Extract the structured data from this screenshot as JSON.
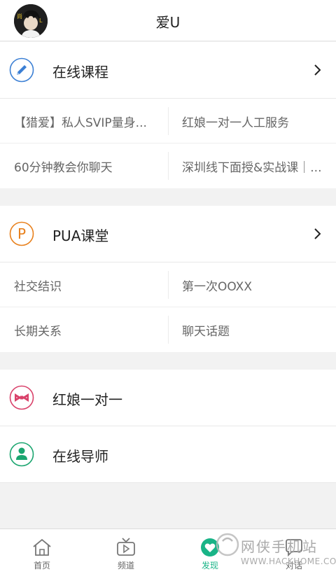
{
  "header": {
    "title": "爱U",
    "avatar": "user-avatar"
  },
  "courses": {
    "title": "在线课程",
    "icon": "pencil-icon",
    "items": [
      "【猎爱】私人SVIP量身...",
      "红娘一对一人工服务",
      "60分钟教会你聊天",
      "深圳线下面授&实战课｜..."
    ]
  },
  "pua": {
    "title": "PUA课堂",
    "icon": "p-badge-icon",
    "items": [
      "社交结识",
      "第一次OOXX",
      "长期关系",
      "聊天话题"
    ]
  },
  "matchmaker": {
    "title": "红娘一对一",
    "icon": "bow-icon"
  },
  "mentor": {
    "title": "在线导师",
    "icon": "person-icon"
  },
  "tabbar": {
    "tabs": [
      {
        "label": "首页",
        "icon": "home-icon"
      },
      {
        "label": "频道",
        "icon": "tv-icon"
      },
      {
        "label": "发现",
        "icon": "discover-icon",
        "active": true
      },
      {
        "label": "对话",
        "icon": "chat-icon"
      }
    ]
  },
  "watermark": {
    "text": "网侠手机站",
    "url": "WWW.HACKHOME.COM"
  },
  "colors": {
    "accent": "#19b487",
    "blue": "#3b7fd4",
    "orange": "#e8801c",
    "pink": "#d9416a",
    "green": "#1aa56f"
  }
}
